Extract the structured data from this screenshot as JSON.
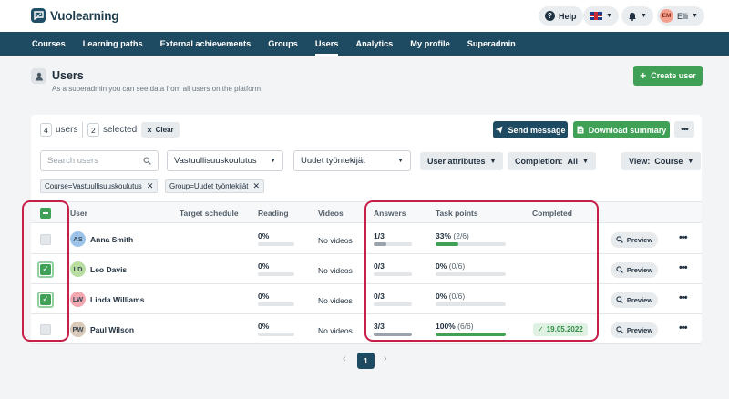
{
  "app": {
    "name": "Vuolearning"
  },
  "topbar": {
    "help_label": "Help",
    "user_initials": "EM",
    "user_name": "Elli"
  },
  "nav": {
    "items": [
      {
        "label": "Courses"
      },
      {
        "label": "Learning paths"
      },
      {
        "label": "External achievements"
      },
      {
        "label": "Groups"
      },
      {
        "label": "Users",
        "active": true
      },
      {
        "label": "Analytics"
      },
      {
        "label": "My profile"
      },
      {
        "label": "Superadmin"
      }
    ]
  },
  "header": {
    "title": "Users",
    "subtitle": "As a superadmin you can see data from all users on the platform",
    "create_button": "Create user"
  },
  "toolbar": {
    "users_count": "4",
    "users_label": "users",
    "selected_count": "2",
    "selected_label": "selected",
    "clear_label": "Clear",
    "send_message": "Send message",
    "download_summary": "Download summary"
  },
  "filters": {
    "search_placeholder": "Search users",
    "course_select": "Vastuullisuuskoulutus",
    "group_select": "Uudet työntekijät",
    "user_attributes": "User attributes",
    "completion_label": "Completion:",
    "completion_value": "All",
    "view_label": "View:",
    "view_value": "Course",
    "chips": [
      {
        "label": "Course=Vastuullisuuskoulutus"
      },
      {
        "label": "Group=Uudet työntekijät"
      }
    ]
  },
  "table": {
    "columns": [
      "User",
      "Target schedule",
      "Reading",
      "Videos",
      "Answers",
      "Task points",
      "Completed"
    ],
    "preview_label": "Preview",
    "rows": [
      {
        "initials": "AS",
        "name": "Anna Smith",
        "reading": "0%",
        "reading_pct": 0,
        "videos": "No videos",
        "answers": "1/3",
        "answers_pct": 33,
        "task_points": "33%",
        "task_points_frac": "(2/6)",
        "task_pct": 33,
        "completed": "",
        "checked": false,
        "avatar_bg": "#9cc4ea"
      },
      {
        "initials": "LD",
        "name": "Leo Davis",
        "reading": "0%",
        "reading_pct": 0,
        "videos": "No videos",
        "answers": "0/3",
        "answers_pct": 0,
        "task_points": "0%",
        "task_points_frac": "(0/6)",
        "task_pct": 0,
        "completed": "",
        "checked": true,
        "avatar_bg": "#b8dda0"
      },
      {
        "initials": "LW",
        "name": "Linda Williams",
        "reading": "0%",
        "reading_pct": 0,
        "videos": "No videos",
        "answers": "0/3",
        "answers_pct": 0,
        "task_points": "0%",
        "task_points_frac": "(0/6)",
        "task_pct": 0,
        "completed": "",
        "checked": true,
        "avatar_bg": "#f3a7b1"
      },
      {
        "initials": "PW",
        "name": "Paul Wilson",
        "reading": "0%",
        "reading_pct": 0,
        "videos": "No videos",
        "answers": "3/3",
        "answers_pct": 100,
        "task_points": "100%",
        "task_points_frac": "(6/6)",
        "task_pct": 100,
        "completed": "19.05.2022",
        "checked": false,
        "avatar_bg": "#d9c9b8"
      }
    ]
  },
  "pagination": {
    "current": "1"
  },
  "colors": {
    "nav": "#1f4b62",
    "green": "#3fa056",
    "highlight": "#c71f48",
    "answers_bar": "#9aa3ab",
    "task_bar": "#3fa056"
  }
}
